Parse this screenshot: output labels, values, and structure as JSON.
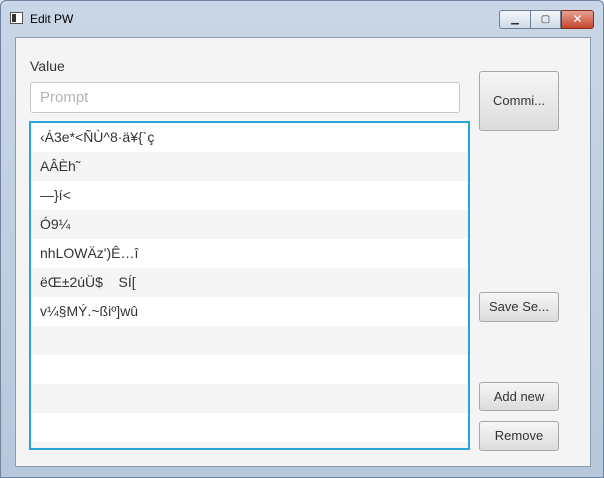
{
  "window": {
    "title": "Edit PW",
    "minimize_glyph": "▁",
    "maximize_glyph": "▢",
    "close_glyph": "✕"
  },
  "form": {
    "value_label": "Value",
    "prompt_placeholder": "Prompt"
  },
  "list": {
    "items": [
      "‹Á3e*<ÑÙ^8·ä¥{`ç",
      "AÂÈh˜",
      "—}í<",
      "Ó9¼",
      "nhLOWÄz')Ê…î",
      "ëŒ±2úÜ$    SÍ[",
      "v¼§MÝ.~ßiº]wû",
      "",
      "",
      "",
      "",
      ""
    ]
  },
  "buttons": {
    "commit": "Commi...",
    "save": "Save Se...",
    "add": "Add new",
    "remove": "Remove"
  },
  "colors": {
    "focus_border": "#28a4d8",
    "close_button": "#c4452e"
  }
}
